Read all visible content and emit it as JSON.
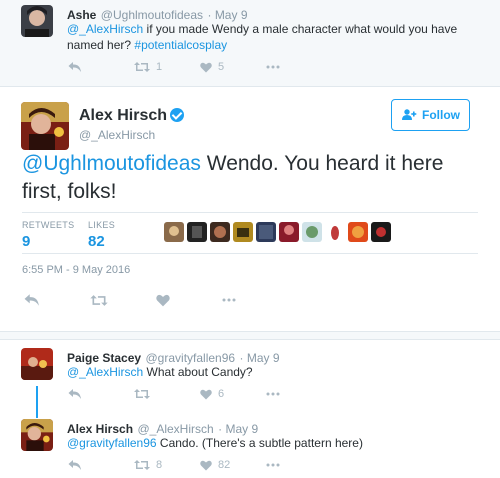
{
  "parent_tweet": {
    "name": "Ashe",
    "handle": "@Ughlmoutofideas",
    "date": "· May 9",
    "mention": "@_AlexHirsch",
    "text": " if you made Wendy a male character what would you have named her? ",
    "hashtag": "#potentialcosplay",
    "retweets": "1",
    "likes": "5"
  },
  "main_tweet": {
    "name": "Alex Hirsch",
    "handle": "@_AlexHirsch",
    "follow_label": "Follow",
    "mention": "@Ughlmoutofideas",
    "text": " Wendo. You heard it here first, folks!",
    "retweets_label": "RETWEETS",
    "retweets_value": "9",
    "likes_label": "LIKES",
    "likes_value": "82",
    "timestamp": "6:55 PM - 9 May 2016"
  },
  "reply_1": {
    "name": "Paige Stacey",
    "handle": "@gravityfallen96",
    "date": "· May 9",
    "mention": "@_AlexHirsch",
    "text": " What about Candy?",
    "likes": "6"
  },
  "reply_2": {
    "name": "Alex Hirsch",
    "handle": "@_AlexHirsch",
    "date": "· May 9",
    "mention": "@gravityfallen96",
    "text": " Cando. (There's a subtle pattern here)",
    "retweets": "8",
    "likes": "82"
  },
  "colors": {
    "accent": "#1da1f2",
    "link": "#1b95e0",
    "muted": "#8899a6",
    "icon": "#aab8c2"
  },
  "icons": [
    "reply-icon",
    "retweet-icon",
    "like-icon",
    "more-icon",
    "verified-icon",
    "follow-person-icon"
  ]
}
